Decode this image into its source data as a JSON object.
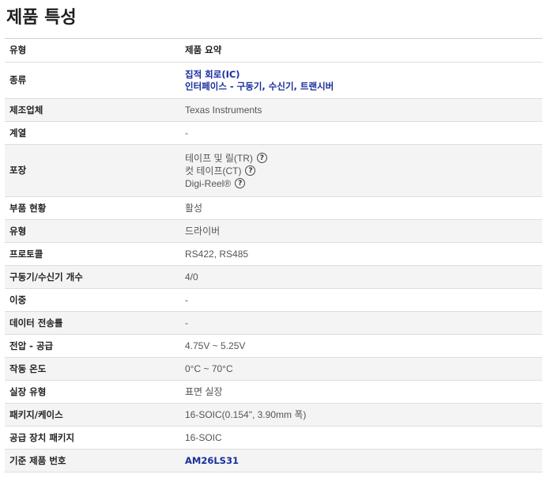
{
  "page": {
    "title": "제품 특성"
  },
  "table": {
    "header": {
      "key": "유형",
      "value": "제품 요약"
    },
    "rows": {
      "category": {
        "key": "종류",
        "links": [
          "집적 회로(IC)",
          "인터페이스 - 구동기, 수신기, 트랜시버"
        ]
      },
      "manufacturer": {
        "key": "제조업체",
        "value": "Texas Instruments"
      },
      "series": {
        "key": "계열",
        "value": "-"
      },
      "packaging": {
        "key": "포장",
        "options": [
          "테이프 및 릴(TR)",
          "컷 테이프(CT)",
          "Digi-Reel®"
        ]
      },
      "part_status": {
        "key": "부품 현황",
        "value": "활성"
      },
      "type": {
        "key": "유형",
        "value": "드라이버"
      },
      "protocol": {
        "key": "프로토콜",
        "value": "RS422, RS485"
      },
      "drivers_receivers": {
        "key": "구동기/수신기 개수",
        "value": "4/0"
      },
      "duplex": {
        "key": "이중",
        "value": "-"
      },
      "data_rate": {
        "key": "데이터 전송률",
        "value": "-"
      },
      "voltage_supply": {
        "key": "전압 - 공급",
        "value": "4.75V ~ 5.25V"
      },
      "operating_temp": {
        "key": "작동 온도",
        "value": "0°C ~ 70°C"
      },
      "mounting_type": {
        "key": "실장 유형",
        "value": "표면 실장"
      },
      "package_case": {
        "key": "패키지/케이스",
        "value": "16-SOIC(0.154\", 3.90mm 폭)"
      },
      "supplier_package": {
        "key": "공급 장치 패키지",
        "value": "16-SOIC"
      },
      "base_part": {
        "key": "기준 제품 번호",
        "link": "AM26LS31"
      }
    }
  },
  "icons": {
    "help": "?"
  },
  "colors": {
    "link": "#1a2e9e",
    "alt_row": "#f4f4f4"
  }
}
